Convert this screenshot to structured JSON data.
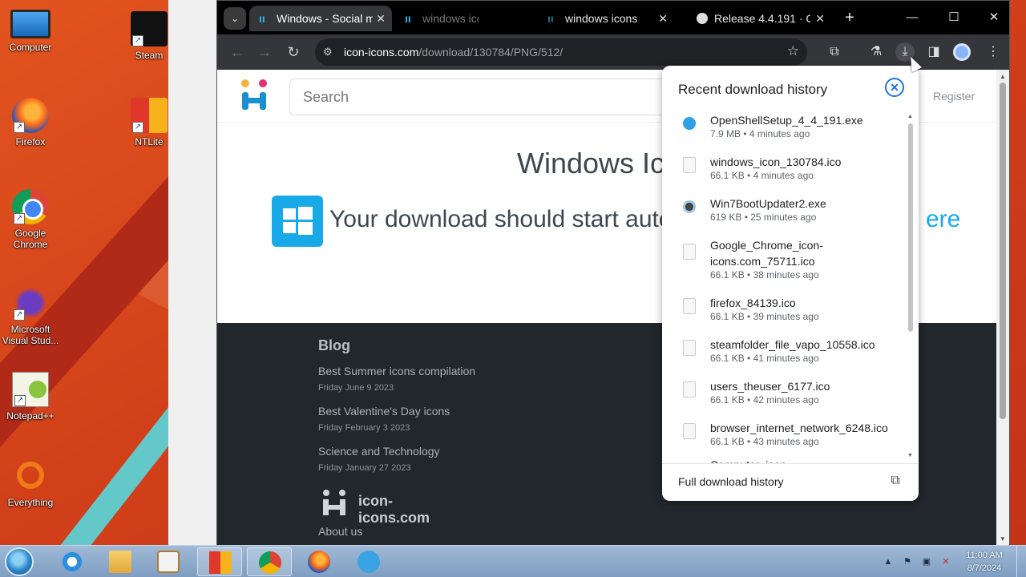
{
  "desktop": {
    "icons": [
      {
        "label": "Computer",
        "icon": "computer-icon"
      },
      {
        "label": "Steam",
        "icon": "steam-icon"
      },
      {
        "label": "Firefox",
        "icon": "firefox-icon"
      },
      {
        "label": "NTLite",
        "icon": "ntlite-icon"
      },
      {
        "label": "Google Chrome",
        "icon": "chrome-icon"
      },
      {
        "label": "Microsoft Visual Stud...",
        "icon": "visual-studio-icon"
      },
      {
        "label": "Notepad++",
        "icon": "notepad-plus-plus-icon"
      },
      {
        "label": "Everything",
        "icon": "everything-icon"
      }
    ]
  },
  "browser": {
    "tabs": [
      {
        "title": "Windows - Social m",
        "icon": "icon-icons-favicon"
      },
      {
        "title": "windows ico",
        "icon": "icon-icons-favicon"
      },
      {
        "title": "windows icons",
        "icon": "icon-icons-favicon"
      },
      {
        "title": "Release 4.4.191 · C",
        "icon": "github-favicon"
      }
    ],
    "new_tab": "+",
    "window_controls": {
      "minimize": "—",
      "maximize": "☐",
      "close": "✕"
    },
    "address": {
      "host": "icon-icons.com",
      "path": "/download/130784/PNG/512/"
    }
  },
  "page": {
    "search_placeholder": "Search",
    "register": "Register",
    "title": "Windows Ic",
    "download_message": "Your download should start auto",
    "download_link": "ere",
    "footer": {
      "blog_heading": "Blog",
      "posts": [
        {
          "title": "Best Summer icons compilation",
          "date": "Friday June 9 2023"
        },
        {
          "title": "Best Valentine's Day icons",
          "date": "Friday February 3 2023"
        },
        {
          "title": "Science and Technology",
          "date": "Friday January 27 2023"
        }
      ],
      "brand": "icon-icons.com",
      "about": "About us"
    }
  },
  "downloads": {
    "title": "Recent download history",
    "items": [
      {
        "name": "OpenShellSetup_4_4_191.exe",
        "meta": "7.9 MB • 4 minutes ago",
        "kind": "exe-blue"
      },
      {
        "name": "windows_icon_130784.ico",
        "meta": "66.1 KB • 4 minutes ago",
        "kind": "file"
      },
      {
        "name": "Win7BootUpdater2.exe",
        "meta": "619 KB • 25 minutes ago",
        "kind": "exe-win7"
      },
      {
        "name": "Google_Chrome_icon-icons.com_75711.ico",
        "meta": "66.1 KB • 38 minutes ago",
        "kind": "file"
      },
      {
        "name": "firefox_84139.ico",
        "meta": "66.1 KB • 39 minutes ago",
        "kind": "file"
      },
      {
        "name": "steamfolder_file_vapo_10558.ico",
        "meta": "66.1 KB • 41 minutes ago",
        "kind": "file"
      },
      {
        "name": "users_theuser_6177.ico",
        "meta": "66.1 KB • 42 minutes ago",
        "kind": "file"
      },
      {
        "name": "browser_internet_network_6248.ico",
        "meta": "66.1 KB • 43 minutes ago",
        "kind": "file"
      },
      {
        "name": "Computer_icon",
        "meta": "",
        "kind": "file"
      }
    ],
    "full_history": "Full download history"
  },
  "taskbar": {
    "clock_time": "11:00 AM",
    "clock_date": "8/7/2024"
  }
}
